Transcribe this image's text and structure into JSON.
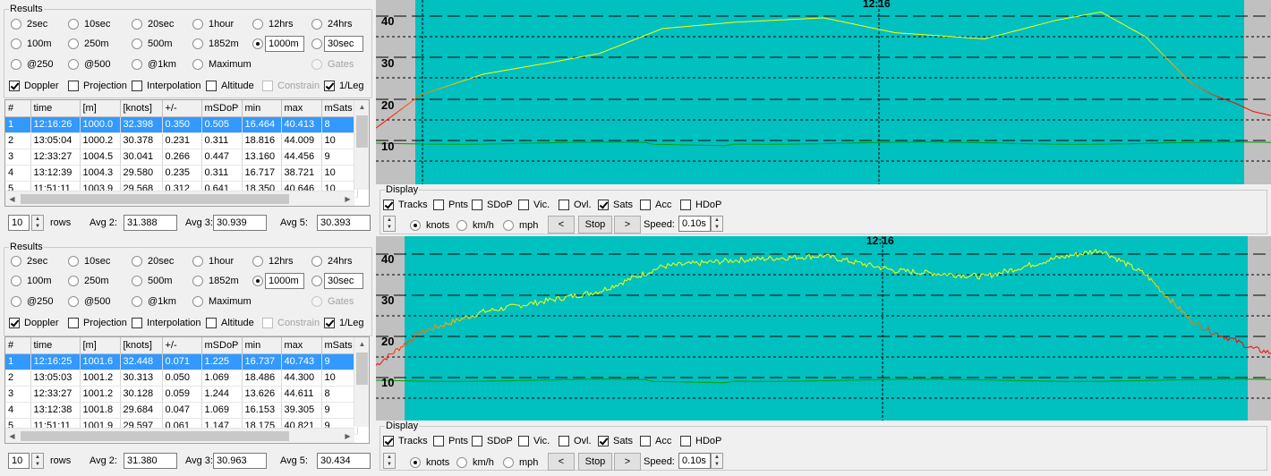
{
  "panels": [
    {
      "results_label": "Results",
      "durations": [
        "2sec",
        "10sec",
        "20sec",
        "1hour",
        "12hrs",
        "24hrs"
      ],
      "distances": [
        "100m",
        "250m",
        "500m",
        "1852m",
        "1000m",
        "30sec"
      ],
      "alphas": [
        "@250",
        "@500",
        "@1km",
        "Maximum",
        "Gates"
      ],
      "checks": [
        "Doppler",
        "Projection",
        "Interpolation",
        "Altitude",
        "Constrain",
        "1/Leg"
      ],
      "columns": [
        "#",
        "time",
        "[m]",
        "[knots]",
        "+/-",
        "mSDoP",
        "min",
        "max",
        "mSats"
      ],
      "rows": [
        [
          "1",
          "12:16:26",
          "1000.0",
          "32.398",
          "0.350",
          "0.505",
          "16.464",
          "40.413",
          "8"
        ],
        [
          "2",
          "13:05:04",
          "1000.2",
          "30.378",
          "0.231",
          "0.311",
          "18.816",
          "44.009",
          "10"
        ],
        [
          "3",
          "12:33:27",
          "1004.5",
          "30.041",
          "0.266",
          "0.447",
          "13.160",
          "44.456",
          "9"
        ],
        [
          "4",
          "13:12:39",
          "1004.3",
          "29.580",
          "0.235",
          "0.311",
          "16.717",
          "38.721",
          "10"
        ],
        [
          "5",
          "11:51:11",
          "1003.9",
          "29.568",
          "0.312",
          "0.641",
          "18.350",
          "40.646",
          "10"
        ]
      ],
      "rows_count": "10",
      "rows_label": "rows",
      "avg2_label": "Avg 2:",
      "avg2": "31.388",
      "avg3_label": "Avg 3:",
      "avg3": "30.939",
      "avg5_label": "Avg 5:",
      "avg5": "30.393",
      "chart": {
        "cursor_label": "12:16",
        "ticks": [
          "40",
          "30",
          "20",
          "10"
        ],
        "curve": "smooth"
      },
      "display": {
        "label": "Display",
        "checks": [
          "Tracks",
          "Pnts",
          "SDoP",
          "Vic.",
          "Ovl.",
          "Sats",
          "Acc",
          "HDoP"
        ],
        "units": [
          "knots",
          "km/h",
          "mph"
        ],
        "prev": "<",
        "stop": "Stop",
        "next": ">",
        "speed_label": "Speed:",
        "speed_value": "0.10s"
      }
    },
    {
      "results_label": "Results",
      "durations": [
        "2sec",
        "10sec",
        "20sec",
        "1hour",
        "12hrs",
        "24hrs"
      ],
      "distances": [
        "100m",
        "250m",
        "500m",
        "1852m",
        "1000m",
        "30sec"
      ],
      "alphas": [
        "@250",
        "@500",
        "@1km",
        "Maximum",
        "Gates"
      ],
      "checks": [
        "Doppler",
        "Projection",
        "Interpolation",
        "Altitude",
        "Constrain",
        "1/Leg"
      ],
      "columns": [
        "#",
        "time",
        "[m]",
        "[knots]",
        "+/-",
        "mSDoP",
        "min",
        "max",
        "mSats"
      ],
      "rows": [
        [
          "1",
          "12:16:25",
          "1001.6",
          "32.448",
          "0.071",
          "1.225",
          "16.737",
          "40.743",
          "9"
        ],
        [
          "2",
          "13:05:03",
          "1001.2",
          "30.313",
          "0.050",
          "1.069",
          "18.486",
          "44.300",
          "10"
        ],
        [
          "3",
          "12:33:27",
          "1001.2",
          "30.128",
          "0.059",
          "1.244",
          "13.626",
          "44.611",
          "8"
        ],
        [
          "4",
          "13:12:38",
          "1001.8",
          "29.684",
          "0.047",
          "1.069",
          "16.153",
          "39.305",
          "9"
        ],
        [
          "5",
          "11:51:11",
          "1001.9",
          "29.597",
          "0.061",
          "1.147",
          "18.175",
          "40.821",
          "9"
        ]
      ],
      "rows_count": "10",
      "rows_label": "rows",
      "avg2_label": "Avg 2:",
      "avg2": "31.380",
      "avg3_label": "Avg 3:",
      "avg3": "30.963",
      "avg5_label": "Avg 5:",
      "avg5": "30.434",
      "chart": {
        "cursor_label": "12:16",
        "ticks": [
          "40",
          "30",
          "20",
          "10"
        ],
        "curve": "noisy"
      },
      "display": {
        "label": "Display",
        "checks": [
          "Tracks",
          "Pnts",
          "SDoP",
          "Vic.",
          "Ovl.",
          "Sats",
          "Acc",
          "HDoP"
        ],
        "units": [
          "knots",
          "km/h",
          "mph"
        ],
        "prev": "<",
        "stop": "Stop",
        "next": ">",
        "speed_label": "Speed:",
        "speed_value": "0.10s"
      }
    }
  ],
  "colors": {
    "chart_bg": "#00c0c0",
    "chart_margin": "#c0c0c0",
    "selected_row": "#3399ff",
    "speed_high": "#ffff00",
    "speed_low": "#ff0000",
    "sats_line": "#00a000"
  }
}
